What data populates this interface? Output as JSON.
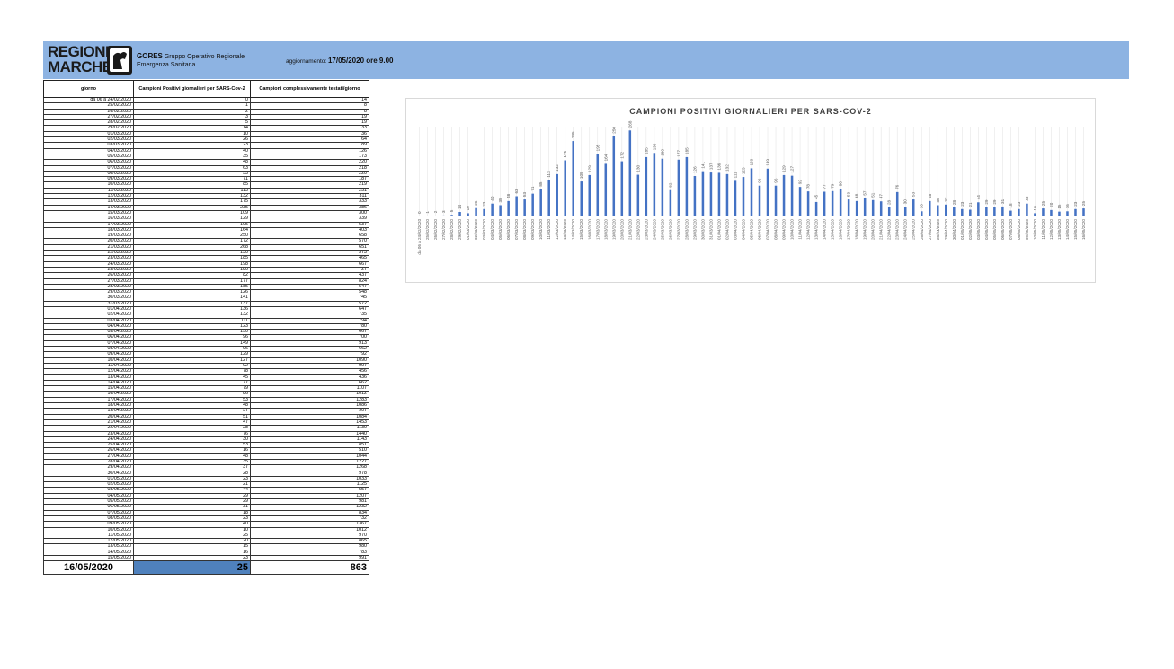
{
  "header": {
    "logo_line1": "REGIONE",
    "logo_line2": "MARCHE",
    "org_name": "GORES",
    "org_line1": "Gruppo Operativo Regionale",
    "org_line2": "Emergenza Sanitaria",
    "update_label": "aggiornamento:",
    "update_value": "17/05/2020 ore 9.00",
    "bg_color": "#8db3e2"
  },
  "table": {
    "headers": [
      "giorno",
      "Campioni Positivi giornalieri per SARS-Cov-2",
      "Campioni complessivamente testati/giorno"
    ],
    "rows": [
      [
        "da 06 a 24/02/2020",
        "0",
        "14"
      ],
      [
        "25/02/2020",
        "1",
        "8"
      ],
      [
        "26/02/2020",
        "2",
        "8"
      ],
      [
        "27/02/2020",
        "3",
        "19"
      ],
      [
        "28/02/2020",
        "5",
        "19"
      ],
      [
        "29/02/2020",
        "14",
        "33"
      ],
      [
        "01/03/2020",
        "10",
        "36"
      ],
      [
        "02/03/2020",
        "26",
        "64"
      ],
      [
        "03/03/2020",
        "23",
        "89"
      ],
      [
        "04/03/2020",
        "40",
        "126"
      ],
      [
        "05/03/2020",
        "35",
        "173"
      ],
      [
        "06/03/2020",
        "48",
        "220"
      ],
      [
        "07/03/2020",
        "63",
        "218"
      ],
      [
        "08/03/2020",
        "53",
        "220"
      ],
      [
        "09/03/2020",
        "71",
        "187"
      ],
      [
        "10/03/2020",
        "85",
        "219"
      ],
      [
        "11/03/2020",
        "113",
        "251"
      ],
      [
        "12/03/2020",
        "132",
        "311"
      ],
      [
        "13/03/2020",
        "175",
        "333"
      ],
      [
        "14/03/2020",
        "235",
        "386"
      ],
      [
        "15/03/2020",
        "109",
        "300"
      ],
      [
        "16/03/2020",
        "129",
        "339"
      ],
      [
        "17/03/2020",
        "195",
        "537"
      ],
      [
        "18/03/2020",
        "164",
        "403"
      ],
      [
        "19/03/2020",
        "250",
        "658"
      ],
      [
        "20/03/2020",
        "172",
        "570"
      ],
      [
        "21/03/2020",
        "268",
        "651"
      ],
      [
        "22/03/2020",
        "130",
        "373"
      ],
      [
        "23/03/2020",
        "185",
        "465"
      ],
      [
        "24/03/2020",
        "198",
        "667"
      ],
      [
        "25/03/2020",
        "180",
        "727"
      ],
      [
        "26/03/2020",
        "82",
        "437"
      ],
      [
        "27/03/2020",
        "177",
        "824"
      ],
      [
        "28/03/2020",
        "185",
        "547"
      ],
      [
        "29/03/2020",
        "126",
        "548"
      ],
      [
        "30/03/2020",
        "141",
        "745"
      ],
      [
        "31/03/2020",
        "137",
        "572"
      ],
      [
        "01/04/2020",
        "136",
        "647"
      ],
      [
        "02/04/2020",
        "132",
        "735"
      ],
      [
        "03/04/2020",
        "111",
        "794"
      ],
      [
        "04/04/2020",
        "123",
        "780"
      ],
      [
        "05/04/2020",
        "150",
        "667"
      ],
      [
        "06/04/2020",
        "96",
        "700"
      ],
      [
        "07/04/2020",
        "149",
        "913"
      ],
      [
        "08/04/2020",
        "96",
        "662"
      ],
      [
        "09/04/2020",
        "129",
        "792"
      ],
      [
        "10/04/2020",
        "127",
        "1090"
      ],
      [
        "11/04/2020",
        "92",
        "907"
      ],
      [
        "12/04/2020",
        "78",
        "456"
      ],
      [
        "13/04/2020",
        "45",
        "436"
      ],
      [
        "14/04/2020",
        "77",
        "662"
      ],
      [
        "15/04/2020",
        "79",
        "1107"
      ],
      [
        "16/04/2020",
        "86",
        "1012"
      ],
      [
        "17/04/2020",
        "53",
        "1283"
      ],
      [
        "18/04/2020",
        "48",
        "1086"
      ],
      [
        "19/04/2020",
        "57",
        "907"
      ],
      [
        "20/04/2020",
        "51",
        "1084"
      ],
      [
        "21/04/2020",
        "47",
        "1453"
      ],
      [
        "22/04/2020",
        "28",
        "1130"
      ],
      [
        "23/04/2020",
        "76",
        "1440"
      ],
      [
        "24/04/2020",
        "30",
        "1143"
      ],
      [
        "25/04/2020",
        "53",
        "851"
      ],
      [
        "26/04/2020",
        "16",
        "510"
      ],
      [
        "27/04/2020",
        "48",
        "1044"
      ],
      [
        "28/04/2020",
        "35",
        "1227"
      ],
      [
        "29/04/2020",
        "37",
        "1268"
      ],
      [
        "30/04/2020",
        "28",
        "978"
      ],
      [
        "01/05/2020",
        "23",
        "1033"
      ],
      [
        "02/05/2020",
        "21",
        "1125"
      ],
      [
        "03/05/2020",
        "44",
        "557"
      ],
      [
        "04/05/2020",
        "29",
        "1207"
      ],
      [
        "05/05/2020",
        "29",
        "981"
      ],
      [
        "06/05/2020",
        "31",
        "1232"
      ],
      [
        "07/05/2020",
        "18",
        "834"
      ],
      [
        "08/05/2020",
        "23",
        "732"
      ],
      [
        "09/05/2020",
        "40",
        "1367"
      ],
      [
        "10/05/2020",
        "10",
        "1012"
      ],
      [
        "11/05/2020",
        "25",
        "970"
      ],
      [
        "12/05/2020",
        "20",
        "865"
      ],
      [
        "13/05/2020",
        "15",
        "980"
      ],
      [
        "14/05/2020",
        "16",
        "783"
      ],
      [
        "15/05/2020",
        "23",
        "991"
      ]
    ],
    "last_row": [
      "16/05/2020",
      "25",
      "863"
    ],
    "highlight_color": "#4f81bd"
  },
  "chart_data": {
    "type": "bar",
    "title": "CAMPIONI POSITIVI GIORNALIERI PER SARS-COV-2",
    "xlabel": "",
    "ylabel": "",
    "grid": true,
    "legend": "none",
    "bar_color": "#4472c4",
    "categories": [
      "da 06 a 24/02/2020",
      "25/02/2020",
      "26/02/2020",
      "27/02/2020",
      "28/02/2020",
      "29/02/2020",
      "01/03/2020",
      "02/03/2020",
      "03/03/2020",
      "04/03/2020",
      "05/03/2020",
      "06/03/2020",
      "07/03/2020",
      "08/03/2020",
      "09/03/2020",
      "10/03/2020",
      "11/03/2020",
      "12/03/2020",
      "13/03/2020",
      "14/03/2020",
      "15/03/2020",
      "16/03/2020",
      "17/03/2020",
      "18/03/2020",
      "19/03/2020",
      "20/03/2020",
      "21/03/2020",
      "22/03/2020",
      "23/03/2020",
      "24/03/2020",
      "25/03/2020",
      "26/03/2020",
      "27/03/2020",
      "28/03/2020",
      "29/03/2020",
      "30/03/2020",
      "31/03/2020",
      "01/04/2020",
      "02/04/2020",
      "03/04/2020",
      "04/04/2020",
      "05/04/2020",
      "06/04/2020",
      "07/04/2020",
      "08/04/2020",
      "09/04/2020",
      "10/04/2020",
      "11/04/2020",
      "12/04/2020",
      "13/04/2020",
      "14/04/2020",
      "15/04/2020",
      "16/04/2020",
      "17/04/2020",
      "18/04/2020",
      "19/04/2020",
      "20/04/2020",
      "21/04/2020",
      "22/04/2020",
      "23/04/2020",
      "24/04/2020",
      "25/04/2020",
      "26/04/2020",
      "27/04/2020",
      "28/04/2020",
      "29/04/2020",
      "30/04/2020",
      "01/05/2020",
      "02/05/2020",
      "03/05/2020",
      "04/05/2020",
      "05/05/2020",
      "06/05/2020",
      "07/05/2020",
      "08/05/2020",
      "09/05/2020",
      "10/05/2020",
      "11/05/2020",
      "12/05/2020",
      "13/05/2020",
      "14/05/2020",
      "15/05/2020",
      "16/05/2020"
    ],
    "values": [
      0,
      1,
      2,
      3,
      5,
      14,
      10,
      26,
      23,
      40,
      35,
      48,
      63,
      53,
      71,
      85,
      113,
      132,
      175,
      235,
      109,
      129,
      195,
      164,
      250,
      172,
      268,
      130,
      185,
      198,
      180,
      82,
      177,
      185,
      126,
      141,
      137,
      136,
      132,
      111,
      123,
      150,
      96,
      149,
      96,
      129,
      127,
      92,
      78,
      45,
      77,
      79,
      86,
      53,
      48,
      57,
      51,
      47,
      28,
      76,
      30,
      53,
      16,
      48,
      35,
      37,
      28,
      23,
      21,
      44,
      29,
      29,
      31,
      18,
      23,
      40,
      10,
      25,
      20,
      15,
      16,
      23,
      25
    ],
    "ylim": [
      0,
      280
    ]
  }
}
